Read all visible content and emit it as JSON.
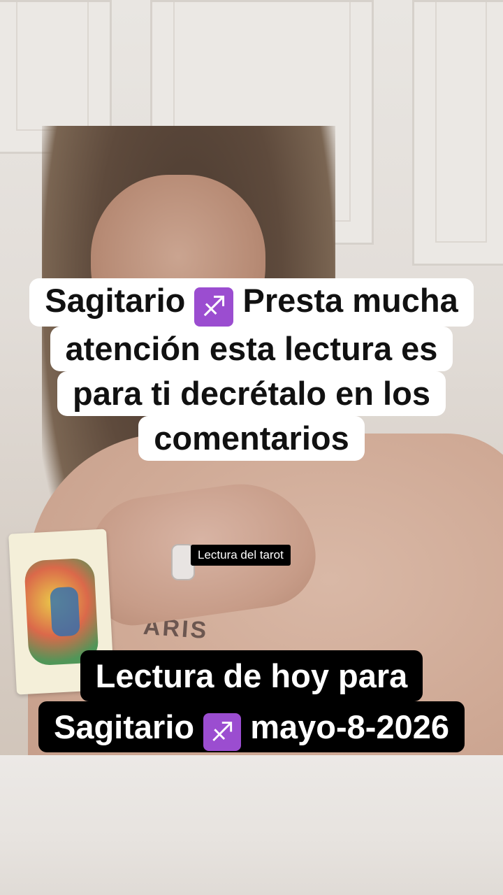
{
  "overlay": {
    "top_caption": {
      "line1_before": "Sagitario",
      "line1_after": "Presta mucha",
      "line2": "atención esta lectura es",
      "line3": "para ti decrétalo en los",
      "line4": "comentarios",
      "emoji": "♐"
    },
    "small_label": "Lectura del tarot",
    "bottom_caption": {
      "line1": "Lectura de hoy para",
      "line2_before": "Sagitario",
      "line2_after": "mayo-8-2026",
      "emoji": "♐"
    }
  },
  "colors": {
    "caption_bg_light": "#ffffff",
    "caption_bg_dark": "#000000",
    "sagittarius_icon": "#9b4dd0"
  },
  "icons": {
    "sagittarius": "sagittarius-emoji-icon"
  }
}
